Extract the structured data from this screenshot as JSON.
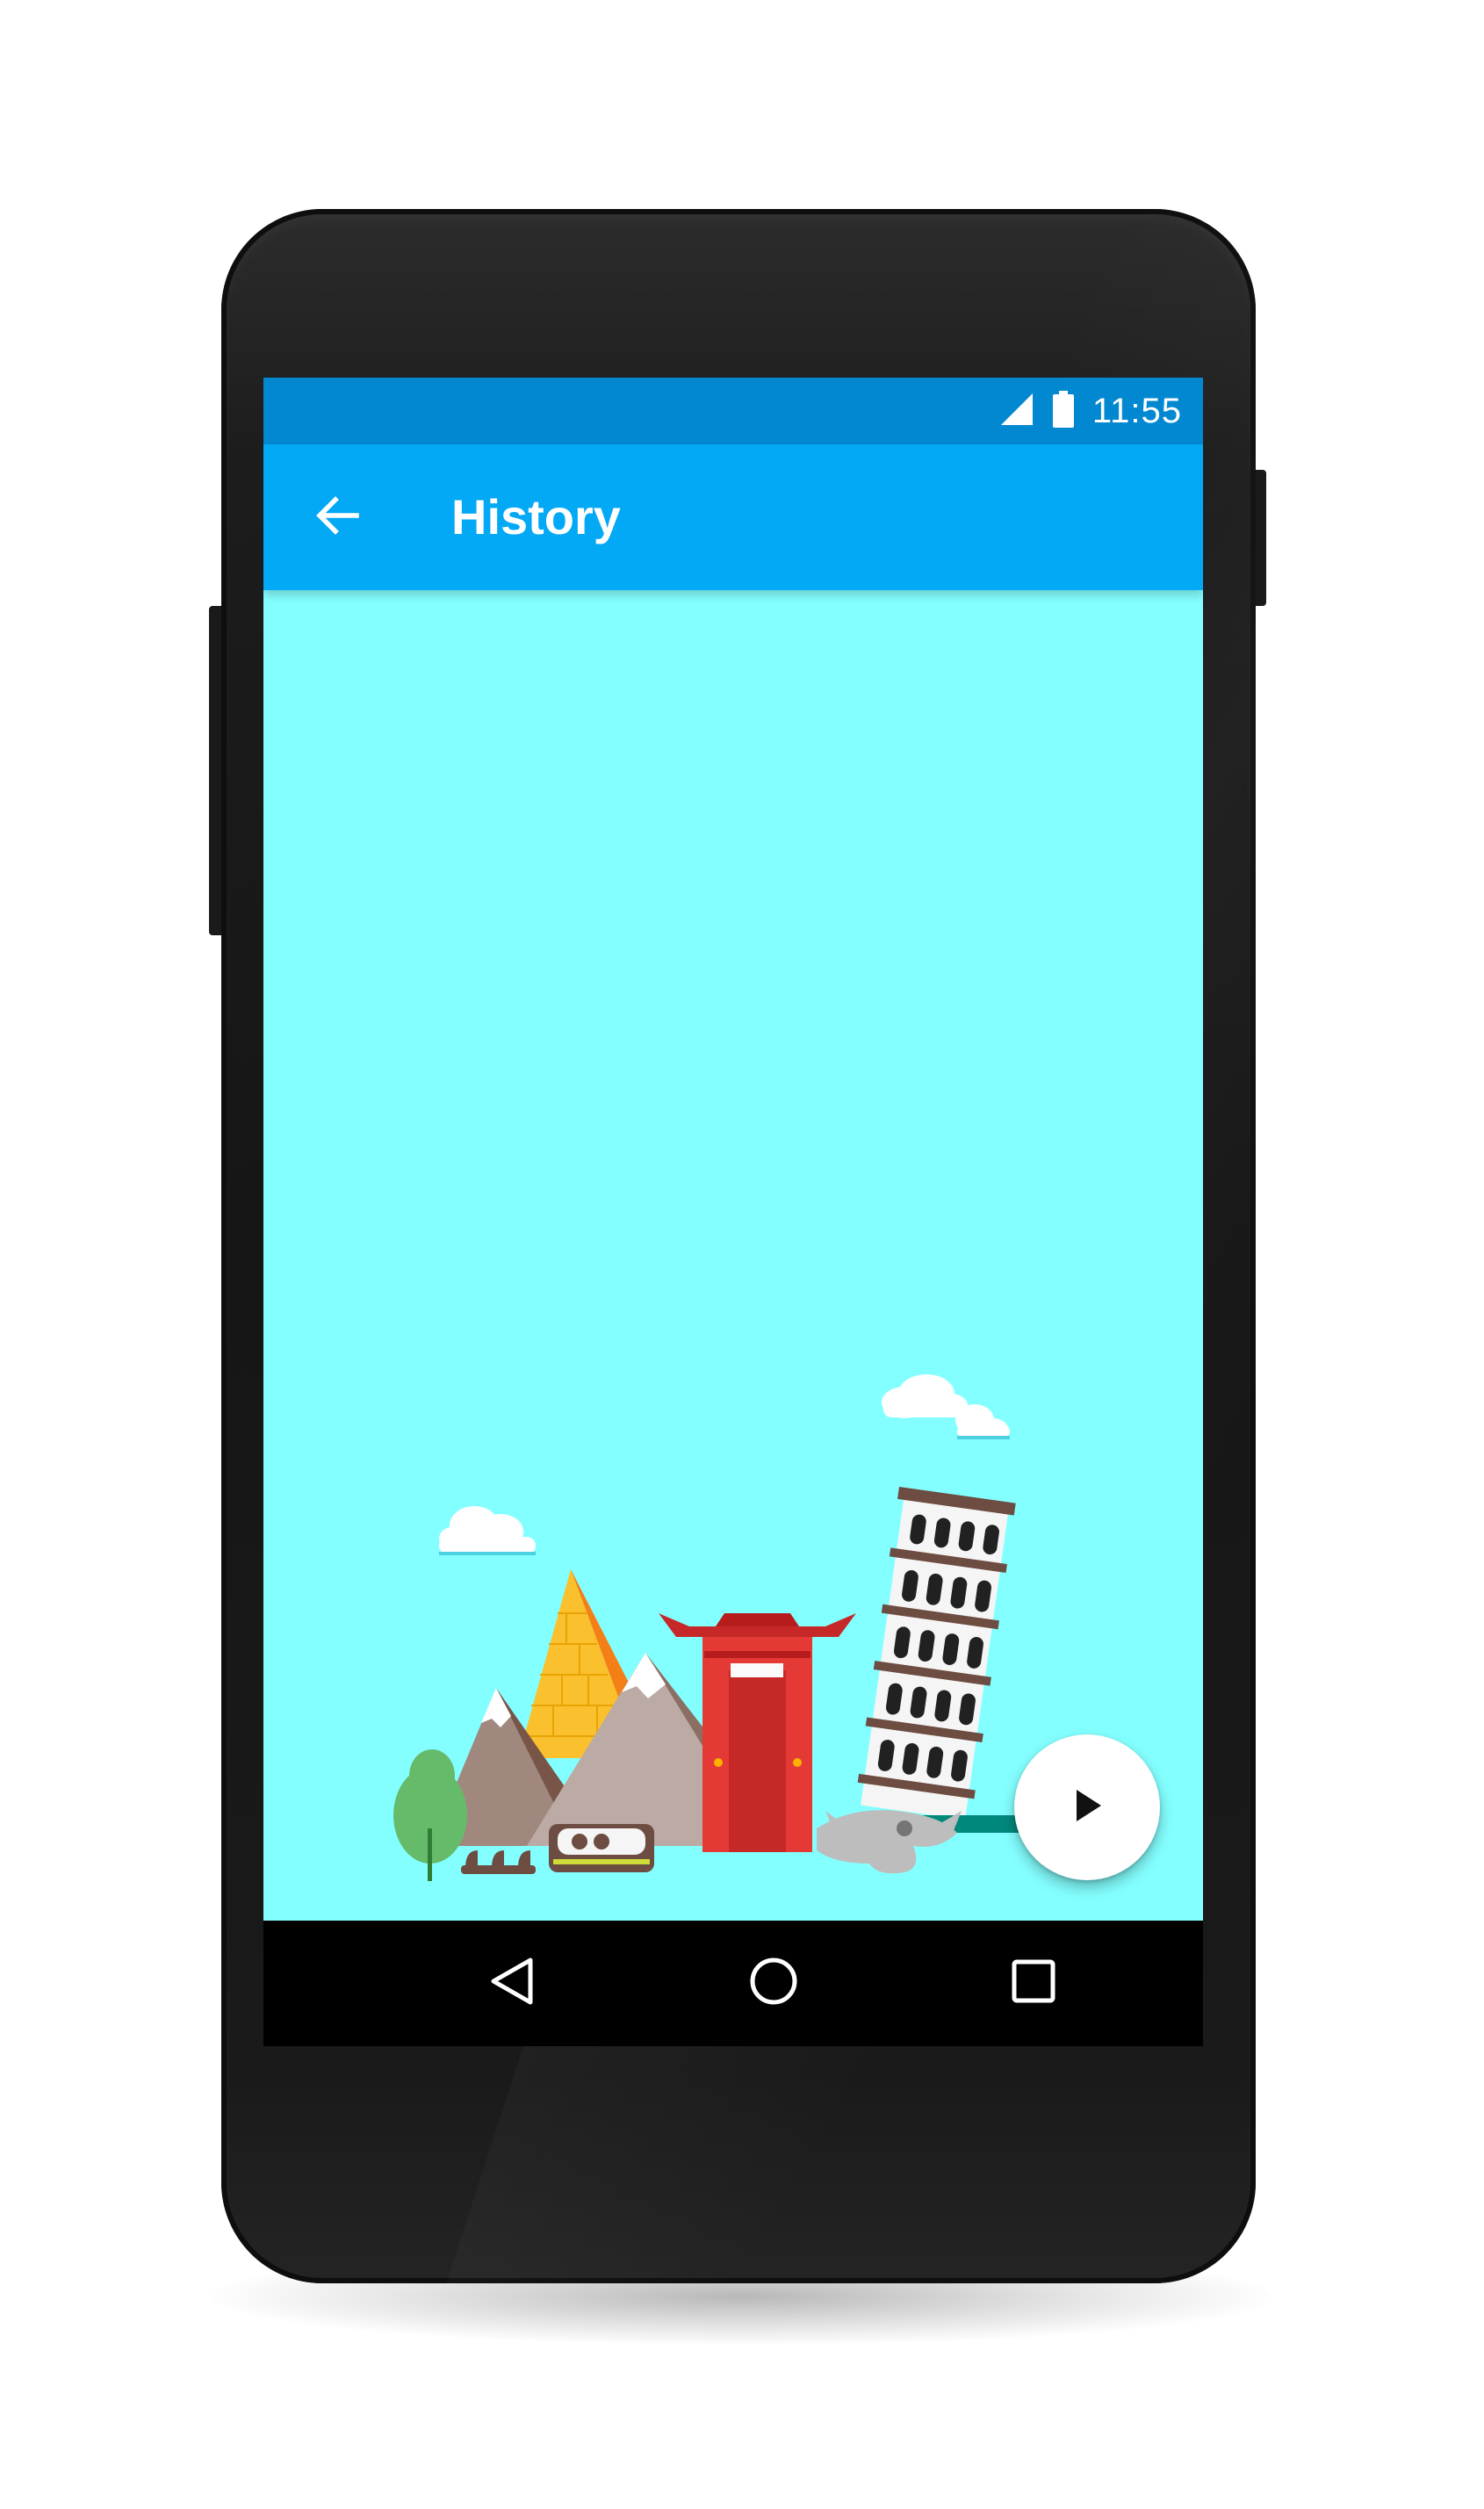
{
  "device": {
    "model_shape": "android-phone-mockup"
  },
  "status_bar": {
    "time": "11:55",
    "icons": [
      "cell-signal-icon",
      "battery-icon"
    ],
    "color": "#0288d1"
  },
  "app_bar": {
    "title": "History",
    "back_icon": "arrow-back-icon",
    "color": "#03a9f4"
  },
  "content": {
    "background_color": "#84ffff",
    "illustration_elements": [
      "cloud",
      "pyramid",
      "mountains",
      "tree",
      "gate",
      "leaning-tower",
      "dinosaur-skull",
      "fossil"
    ]
  },
  "fab": {
    "icon": "play-icon",
    "color": "#ffffff"
  },
  "nav_bar": {
    "buttons": [
      "back-triangle-icon",
      "home-circle-icon",
      "recents-square-icon"
    ]
  }
}
